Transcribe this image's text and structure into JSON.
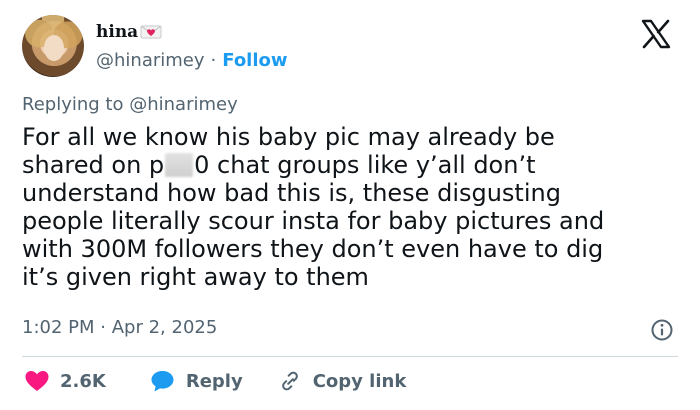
{
  "author": {
    "display_name": "hina",
    "name_emoji": "love-letter-icon",
    "handle": "@hinarimey",
    "separator": "·",
    "follow_label": "Follow"
  },
  "reply_context": {
    "prefix": "Replying to",
    "mention": "@hinarimey"
  },
  "tweet": {
    "lines": [
      "For all we know his baby pic may already be",
      [
        "shared on p",
        "0 chat groups like y’all don’t"
      ],
      "understand how bad this is, these disgusting",
      "people literally scour insta for baby pictures and",
      "with 300M followers they don’t even have to dig",
      "it’s given right away to them"
    ],
    "time": "1:02 PM",
    "separator": "·",
    "date": "Apr 2, 2025"
  },
  "actions": {
    "like_count": "2.6K",
    "reply_label": "Reply",
    "copy_label": "Copy link"
  },
  "colors": {
    "link": "#1d9bf0",
    "like": "#f91880",
    "reply_icon": "#1d9bf0",
    "copy_icon": "#536471",
    "secondary_text": "#536471"
  }
}
